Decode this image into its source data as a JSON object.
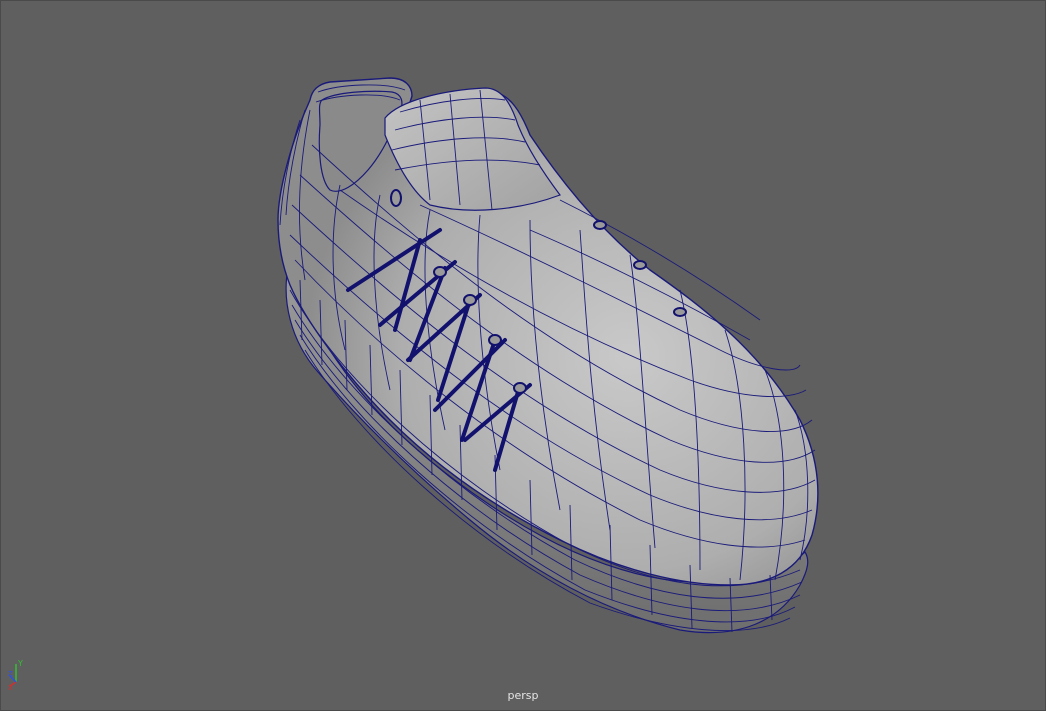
{
  "viewport": {
    "camera_name": "persp",
    "background_color": "#5f5f5f",
    "wireframe_color": "#1a1a7a",
    "shaded_color": "#b5b5b5"
  },
  "axis_gizmo": {
    "x_label": "X",
    "y_label": "Y",
    "z_label": "Z",
    "x_color": "#d03030",
    "y_color": "#30c030",
    "z_color": "#3050e0"
  },
  "scene": {
    "object": "sneaker-model",
    "display_mode": "wireframe-on-shaded"
  }
}
